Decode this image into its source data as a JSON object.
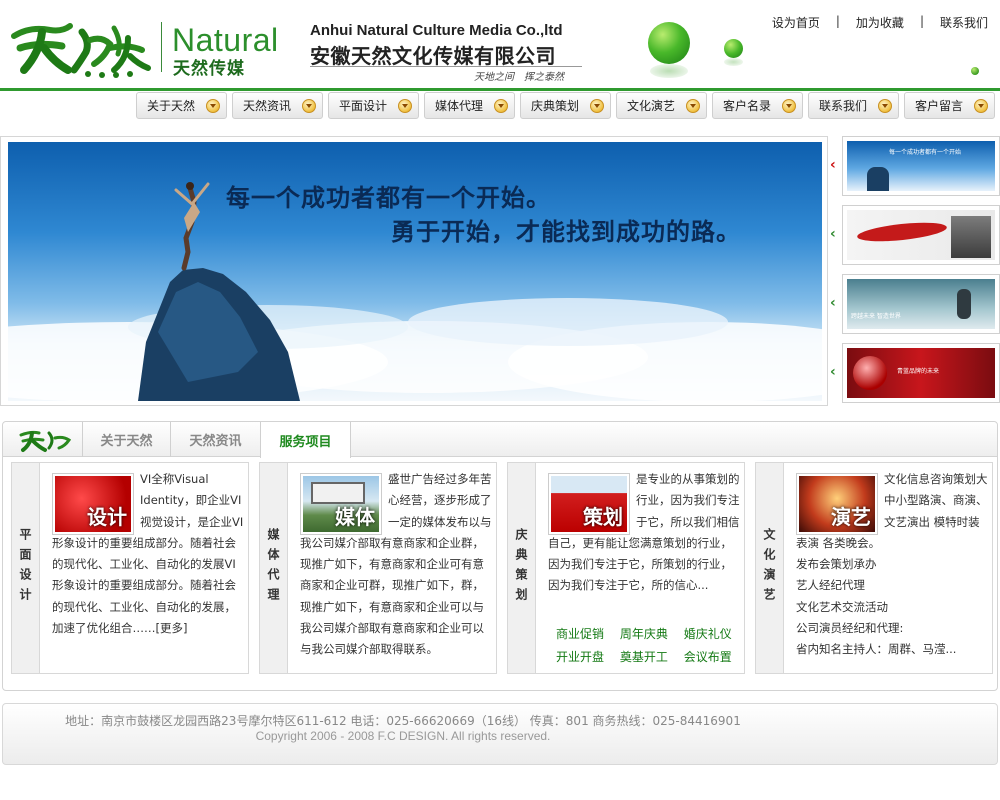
{
  "header": {
    "logo_cn_big": "天然",
    "logo_en": "Natural",
    "logo_cn": "天然传媒",
    "company_en": "Anhui Natural Culture Media Co.,ltd",
    "company_cn": "安徽天然文化传媒有限公司",
    "slogan": "天地之间　挥之泰然",
    "top_links": [
      "设为首页",
      "加为收藏",
      "联系我们"
    ],
    "brand_green": "#2f9a2f"
  },
  "nav": {
    "items": [
      "关于天然",
      "天然资讯",
      "平面设计",
      "媒体代理",
      "庆典策划",
      "文化演艺",
      "客户名录",
      "联系我们",
      "客户留言"
    ]
  },
  "banner": {
    "line1": "每一个成功者都有一个开始。",
    "line2": "勇于开始，才能找到成功的路。"
  },
  "thumbs": [
    {
      "caption": "每一个成功者都有一个开始",
      "active": true
    },
    {
      "caption": "",
      "active": false
    },
    {
      "caption": "跨越未来 智造世界",
      "active": false
    },
    {
      "caption": "青蓝品牌的未来",
      "active": false
    }
  ],
  "services": {
    "tabs": [
      "关于天然",
      "天然资讯",
      "服务项目"
    ],
    "active_tab": "服务项目",
    "tab_logo": "天然",
    "cards": [
      {
        "side": "平面设计",
        "thumb_label": "设计",
        "text": "VI全称Visual Identity，即企业VI视觉设计，是企业VI形象设计的重要组成部分。随着社会的现代化、工业化、自动化的发展VI形象设计的重要组成部分。随着社会的现代化、工业化、自动化的发展，加速了优化组合……",
        "more": "[更多]",
        "links": []
      },
      {
        "side": "媒体代理",
        "thumb_label": "媒体",
        "text": "盛世广告经过多年苦心经营，逐步形成了一定的媒体发布以与我公司媒介部取有意商家和企业群，现推广如下，有意商家和企业可有意商家和企业可群，现推广如下，群，现推广如下，有意商家和企业可以与我公司媒介部取有意商家和企业可以与我公司媒介部取得联系。",
        "more": "",
        "links": []
      },
      {
        "side": "庆典策划",
        "thumb_label": "策划",
        "text": "是专业的从事策划的行业，因为我们专注于它，所以我们相信自己，更有能让您满意策划的行业，因为我们专注于它，所策划的行业，因为我们专注于它，所的信心...",
        "more": "",
        "links": [
          "商业促销",
          "周年庆典",
          "婚庆礼仪",
          "开业开盘",
          "奠基开工",
          "会议布置"
        ]
      },
      {
        "side": "文化演艺",
        "thumb_label": "演艺",
        "text": "文化信息咨询策划大中小型路演、商演、文艺演出 模特时装表演 各类晚会。",
        "more": "",
        "lines": [
          "发布会策划承办",
          "艺人经纪代理",
          "文化艺术交流活动",
          "公司演员经纪和代理:",
          "省内知名主持人：周群、马滢..."
        ],
        "links": []
      }
    ]
  },
  "footer": {
    "line1": "地址：南京市鼓楼区龙园西路23号摩尔特区611-612  电话：025-66620669（16线） 传真：801  商务热线：025-84416901",
    "line2": "Copyright 2006 - 2008 F.C DESIGN. All rights reserved."
  }
}
